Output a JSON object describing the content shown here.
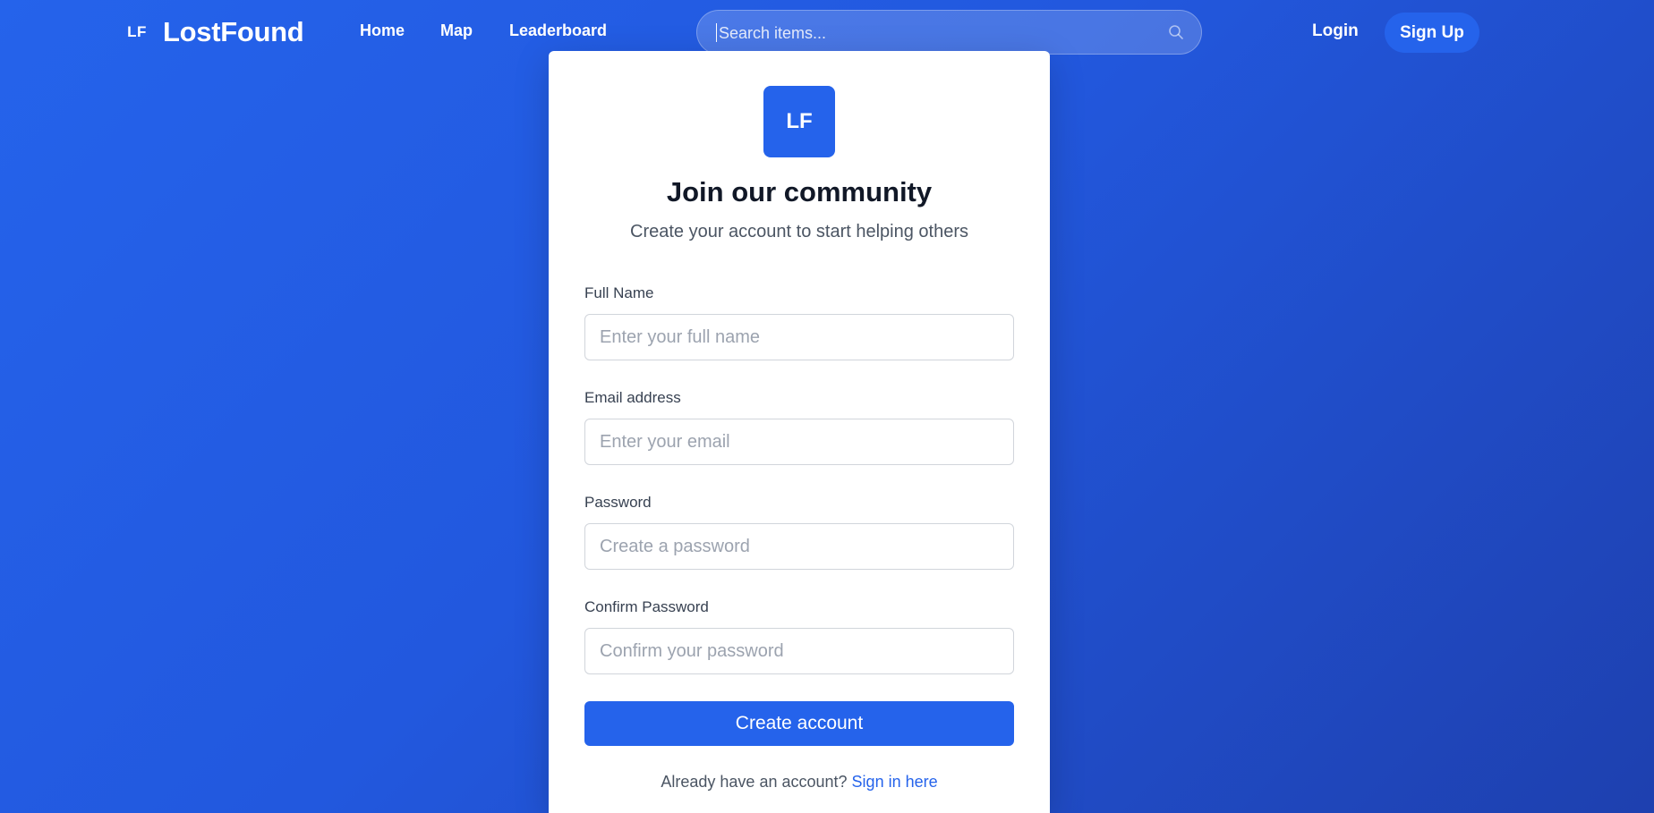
{
  "navbar": {
    "brand_mark": "LF",
    "brand_name": "LostFound",
    "links": [
      {
        "label": "Home"
      },
      {
        "label": "Map"
      },
      {
        "label": "Leaderboard"
      }
    ],
    "search_placeholder": "Search items...",
    "search_icon": "search-icon",
    "login_label": "Login",
    "signup_label": "Sign Up"
  },
  "form": {
    "logo_text": "LF",
    "title": "Join our community",
    "subtitle": "Create your account to start helping others",
    "fields": [
      {
        "label": "Full Name",
        "placeholder": "Enter your full name",
        "value": ""
      },
      {
        "label": "Email address",
        "placeholder": "Enter your email",
        "value": ""
      },
      {
        "label": "Password",
        "placeholder": "Create a password",
        "value": ""
      },
      {
        "label": "Confirm Password",
        "placeholder": "Confirm your password",
        "value": ""
      }
    ],
    "submit_label": "Create account",
    "footer_text": "Already have an account?",
    "footer_link": "Sign in here"
  },
  "colors": {
    "background": "#2563eb",
    "primary": "#2563eb",
    "title_text": "#111827",
    "muted_text": "#4b5563"
  }
}
